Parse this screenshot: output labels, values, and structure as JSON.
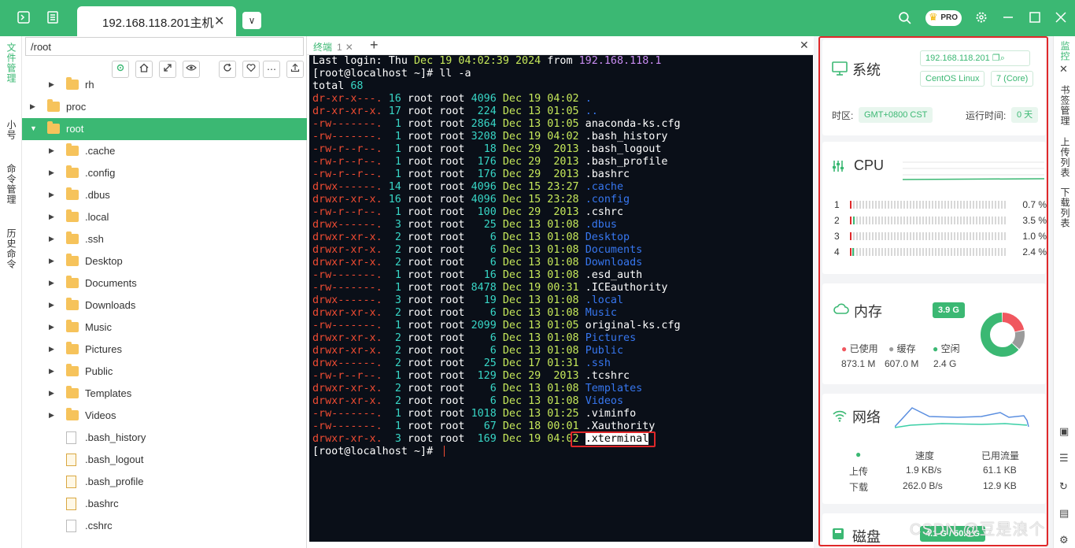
{
  "topbar": {
    "tab_title": "192.168.118.201主机",
    "tab_close": "✕",
    "dropdown": "∨",
    "pro_badge": "PRO"
  },
  "left_tabs": [
    "文件管理",
    "小号",
    "命令管理",
    "历史命令"
  ],
  "file_panel": {
    "path": "/root",
    "tree": [
      {
        "label": "rh",
        "type": "folder",
        "indent": 1,
        "arrow": "▶"
      },
      {
        "label": "proc",
        "type": "folder",
        "indent": 0,
        "arrow": "▶"
      },
      {
        "label": "root",
        "type": "folder",
        "indent": 0,
        "arrow": "▼",
        "selected": true
      },
      {
        "label": ".cache",
        "type": "folder",
        "indent": 1,
        "arrow": "▶"
      },
      {
        "label": ".config",
        "type": "folder",
        "indent": 1,
        "arrow": "▶"
      },
      {
        "label": ".dbus",
        "type": "folder",
        "indent": 1,
        "arrow": "▶"
      },
      {
        "label": ".local",
        "type": "folder",
        "indent": 1,
        "arrow": "▶"
      },
      {
        "label": ".ssh",
        "type": "folder",
        "indent": 1,
        "arrow": "▶"
      },
      {
        "label": "Desktop",
        "type": "folder",
        "indent": 1,
        "arrow": "▶"
      },
      {
        "label": "Documents",
        "type": "folder",
        "indent": 1,
        "arrow": "▶"
      },
      {
        "label": "Downloads",
        "type": "folder",
        "indent": 1,
        "arrow": "▶"
      },
      {
        "label": "Music",
        "type": "folder",
        "indent": 1,
        "arrow": "▶"
      },
      {
        "label": "Pictures",
        "type": "folder",
        "indent": 1,
        "arrow": "▶"
      },
      {
        "label": "Public",
        "type": "folder",
        "indent": 1,
        "arrow": "▶"
      },
      {
        "label": "Templates",
        "type": "folder",
        "indent": 1,
        "arrow": "▶"
      },
      {
        "label": "Videos",
        "type": "folder",
        "indent": 1,
        "arrow": "▶"
      },
      {
        "label": ".bash_history",
        "type": "file",
        "indent": 1,
        "arrow": ""
      },
      {
        "label": ".bash_logout",
        "type": "term",
        "indent": 1,
        "arrow": ""
      },
      {
        "label": ".bash_profile",
        "type": "term",
        "indent": 1,
        "arrow": ""
      },
      {
        "label": ".bashrc",
        "type": "term",
        "indent": 1,
        "arrow": ""
      },
      {
        "label": ".cshrc",
        "type": "file",
        "indent": 1,
        "arrow": ""
      }
    ]
  },
  "terminal": {
    "tab_label": "终端",
    "tab_num": "1",
    "lines": [
      [
        [
          "c-white",
          "Last login: Thu "
        ],
        [
          "c-green",
          "Dec 19 04:02:39 2024"
        ],
        [
          "c-white",
          " from "
        ],
        [
          "c-purple",
          "192.168.118.1"
        ]
      ],
      [
        [
          "c-white",
          "[root@localhost ~]# ll -a"
        ]
      ],
      [
        [
          "c-white",
          "total "
        ],
        [
          "c-cyan",
          "68"
        ]
      ],
      [
        [
          "c-red",
          "dr-xr-x---."
        ],
        [
          "c-white",
          " "
        ],
        [
          "c-cyan",
          "16"
        ],
        [
          "c-white",
          " root root "
        ],
        [
          "c-cyan",
          "4096"
        ],
        [
          "c-white",
          " "
        ],
        [
          "c-green",
          "Dec 19 04:02"
        ],
        [
          "c-white",
          " "
        ],
        [
          "c-blue",
          "."
        ]
      ],
      [
        [
          "c-red",
          "dr-xr-xr-x."
        ],
        [
          "c-white",
          " "
        ],
        [
          "c-cyan",
          "17"
        ],
        [
          "c-white",
          " root root  "
        ],
        [
          "c-cyan",
          "224"
        ],
        [
          "c-white",
          " "
        ],
        [
          "c-green",
          "Dec 13 01:05"
        ],
        [
          "c-white",
          " "
        ],
        [
          "c-blue",
          ".."
        ]
      ],
      [
        [
          "c-red",
          "-rw-------."
        ],
        [
          "c-white",
          "  "
        ],
        [
          "c-cyan",
          "1"
        ],
        [
          "c-white",
          " root root "
        ],
        [
          "c-cyan",
          "2864"
        ],
        [
          "c-white",
          " "
        ],
        [
          "c-green",
          "Dec 13 01:05"
        ],
        [
          "c-white",
          " anaconda-ks.cfg"
        ]
      ],
      [
        [
          "c-red",
          "-rw-------."
        ],
        [
          "c-white",
          "  "
        ],
        [
          "c-cyan",
          "1"
        ],
        [
          "c-white",
          " root root "
        ],
        [
          "c-cyan",
          "3208"
        ],
        [
          "c-white",
          " "
        ],
        [
          "c-green",
          "Dec 19 04:02"
        ],
        [
          "c-white",
          " .bash_history"
        ]
      ],
      [
        [
          "c-red",
          "-rw-r--r--."
        ],
        [
          "c-white",
          "  "
        ],
        [
          "c-cyan",
          "1"
        ],
        [
          "c-white",
          " root root   "
        ],
        [
          "c-cyan",
          "18"
        ],
        [
          "c-white",
          " "
        ],
        [
          "c-green",
          "Dec 29  2013"
        ],
        [
          "c-white",
          " .bash_logout"
        ]
      ],
      [
        [
          "c-red",
          "-rw-r--r--."
        ],
        [
          "c-white",
          "  "
        ],
        [
          "c-cyan",
          "1"
        ],
        [
          "c-white",
          " root root  "
        ],
        [
          "c-cyan",
          "176"
        ],
        [
          "c-white",
          " "
        ],
        [
          "c-green",
          "Dec 29  2013"
        ],
        [
          "c-white",
          " .bash_profile"
        ]
      ],
      [
        [
          "c-red",
          "-rw-r--r--."
        ],
        [
          "c-white",
          "  "
        ],
        [
          "c-cyan",
          "1"
        ],
        [
          "c-white",
          " root root  "
        ],
        [
          "c-cyan",
          "176"
        ],
        [
          "c-white",
          " "
        ],
        [
          "c-green",
          "Dec 29  2013"
        ],
        [
          "c-white",
          " .bashrc"
        ]
      ],
      [
        [
          "c-red",
          "drwx------."
        ],
        [
          "c-white",
          " "
        ],
        [
          "c-cyan",
          "14"
        ],
        [
          "c-white",
          " root root "
        ],
        [
          "c-cyan",
          "4096"
        ],
        [
          "c-white",
          " "
        ],
        [
          "c-green",
          "Dec 15 23:27"
        ],
        [
          "c-white",
          " "
        ],
        [
          "c-blue",
          ".cache"
        ]
      ],
      [
        [
          "c-red",
          "drwxr-xr-x."
        ],
        [
          "c-white",
          " "
        ],
        [
          "c-cyan",
          "16"
        ],
        [
          "c-white",
          " root root "
        ],
        [
          "c-cyan",
          "4096"
        ],
        [
          "c-white",
          " "
        ],
        [
          "c-green",
          "Dec 15 23:28"
        ],
        [
          "c-white",
          " "
        ],
        [
          "c-blue",
          ".config"
        ]
      ],
      [
        [
          "c-red",
          "-rw-r--r--."
        ],
        [
          "c-white",
          "  "
        ],
        [
          "c-cyan",
          "1"
        ],
        [
          "c-white",
          " root root  "
        ],
        [
          "c-cyan",
          "100"
        ],
        [
          "c-white",
          " "
        ],
        [
          "c-green",
          "Dec 29  2013"
        ],
        [
          "c-white",
          " .cshrc"
        ]
      ],
      [
        [
          "c-red",
          "drwx------."
        ],
        [
          "c-white",
          "  "
        ],
        [
          "c-cyan",
          "3"
        ],
        [
          "c-white",
          " root root   "
        ],
        [
          "c-cyan",
          "25"
        ],
        [
          "c-white",
          " "
        ],
        [
          "c-green",
          "Dec 13 01:08"
        ],
        [
          "c-white",
          " "
        ],
        [
          "c-blue",
          ".dbus"
        ]
      ],
      [
        [
          "c-red",
          "drwxr-xr-x."
        ],
        [
          "c-white",
          "  "
        ],
        [
          "c-cyan",
          "2"
        ],
        [
          "c-white",
          " root root    "
        ],
        [
          "c-cyan",
          "6"
        ],
        [
          "c-white",
          " "
        ],
        [
          "c-green",
          "Dec 13 01:08"
        ],
        [
          "c-white",
          " "
        ],
        [
          "c-blue",
          "Desktop"
        ]
      ],
      [
        [
          "c-red",
          "drwxr-xr-x."
        ],
        [
          "c-white",
          "  "
        ],
        [
          "c-cyan",
          "2"
        ],
        [
          "c-white",
          " root root    "
        ],
        [
          "c-cyan",
          "6"
        ],
        [
          "c-white",
          " "
        ],
        [
          "c-green",
          "Dec 13 01:08"
        ],
        [
          "c-white",
          " "
        ],
        [
          "c-blue",
          "Documents"
        ]
      ],
      [
        [
          "c-red",
          "drwxr-xr-x."
        ],
        [
          "c-white",
          "  "
        ],
        [
          "c-cyan",
          "2"
        ],
        [
          "c-white",
          " root root    "
        ],
        [
          "c-cyan",
          "6"
        ],
        [
          "c-white",
          " "
        ],
        [
          "c-green",
          "Dec 13 01:08"
        ],
        [
          "c-white",
          " "
        ],
        [
          "c-blue",
          "Downloads"
        ]
      ],
      [
        [
          "c-red",
          "-rw-------."
        ],
        [
          "c-white",
          "  "
        ],
        [
          "c-cyan",
          "1"
        ],
        [
          "c-white",
          " root root   "
        ],
        [
          "c-cyan",
          "16"
        ],
        [
          "c-white",
          " "
        ],
        [
          "c-green",
          "Dec 13 01:08"
        ],
        [
          "c-white",
          " .esd_auth"
        ]
      ],
      [
        [
          "c-red",
          "-rw-------."
        ],
        [
          "c-white",
          "  "
        ],
        [
          "c-cyan",
          "1"
        ],
        [
          "c-white",
          " root root "
        ],
        [
          "c-cyan",
          "8478"
        ],
        [
          "c-white",
          " "
        ],
        [
          "c-green",
          "Dec 19 00:31"
        ],
        [
          "c-white",
          " .ICEauthority"
        ]
      ],
      [
        [
          "c-red",
          "drwx------."
        ],
        [
          "c-white",
          "  "
        ],
        [
          "c-cyan",
          "3"
        ],
        [
          "c-white",
          " root root   "
        ],
        [
          "c-cyan",
          "19"
        ],
        [
          "c-white",
          " "
        ],
        [
          "c-green",
          "Dec 13 01:08"
        ],
        [
          "c-white",
          " "
        ],
        [
          "c-blue",
          ".local"
        ]
      ],
      [
        [
          "c-red",
          "drwxr-xr-x."
        ],
        [
          "c-white",
          "  "
        ],
        [
          "c-cyan",
          "2"
        ],
        [
          "c-white",
          " root root    "
        ],
        [
          "c-cyan",
          "6"
        ],
        [
          "c-white",
          " "
        ],
        [
          "c-green",
          "Dec 13 01:08"
        ],
        [
          "c-white",
          " "
        ],
        [
          "c-blue",
          "Music"
        ]
      ],
      [
        [
          "c-red",
          "-rw-------."
        ],
        [
          "c-white",
          "  "
        ],
        [
          "c-cyan",
          "1"
        ],
        [
          "c-white",
          " root root "
        ],
        [
          "c-cyan",
          "2099"
        ],
        [
          "c-white",
          " "
        ],
        [
          "c-green",
          "Dec 13 01:05"
        ],
        [
          "c-white",
          " original-ks.cfg"
        ]
      ],
      [
        [
          "c-red",
          "drwxr-xr-x."
        ],
        [
          "c-white",
          "  "
        ],
        [
          "c-cyan",
          "2"
        ],
        [
          "c-white",
          " root root    "
        ],
        [
          "c-cyan",
          "6"
        ],
        [
          "c-white",
          " "
        ],
        [
          "c-green",
          "Dec 13 01:08"
        ],
        [
          "c-white",
          " "
        ],
        [
          "c-blue",
          "Pictures"
        ]
      ],
      [
        [
          "c-red",
          "drwxr-xr-x."
        ],
        [
          "c-white",
          "  "
        ],
        [
          "c-cyan",
          "2"
        ],
        [
          "c-white",
          " root root    "
        ],
        [
          "c-cyan",
          "6"
        ],
        [
          "c-white",
          " "
        ],
        [
          "c-green",
          "Dec 13 01:08"
        ],
        [
          "c-white",
          " "
        ],
        [
          "c-blue",
          "Public"
        ]
      ],
      [
        [
          "c-red",
          "drwx------."
        ],
        [
          "c-white",
          "  "
        ],
        [
          "c-cyan",
          "2"
        ],
        [
          "c-white",
          " root root   "
        ],
        [
          "c-cyan",
          "25"
        ],
        [
          "c-white",
          " "
        ],
        [
          "c-green",
          "Dec 17 01:31"
        ],
        [
          "c-white",
          " "
        ],
        [
          "c-blue",
          ".ssh"
        ]
      ],
      [
        [
          "c-red",
          "-rw-r--r--."
        ],
        [
          "c-white",
          "  "
        ],
        [
          "c-cyan",
          "1"
        ],
        [
          "c-white",
          " root root  "
        ],
        [
          "c-cyan",
          "129"
        ],
        [
          "c-white",
          " "
        ],
        [
          "c-green",
          "Dec 29  2013"
        ],
        [
          "c-white",
          " .tcshrc"
        ]
      ],
      [
        [
          "c-red",
          "drwxr-xr-x."
        ],
        [
          "c-white",
          "  "
        ],
        [
          "c-cyan",
          "2"
        ],
        [
          "c-white",
          " root root    "
        ],
        [
          "c-cyan",
          "6"
        ],
        [
          "c-white",
          " "
        ],
        [
          "c-green",
          "Dec 13 01:08"
        ],
        [
          "c-white",
          " "
        ],
        [
          "c-blue",
          "Templates"
        ]
      ],
      [
        [
          "c-red",
          "drwxr-xr-x."
        ],
        [
          "c-white",
          "  "
        ],
        [
          "c-cyan",
          "2"
        ],
        [
          "c-white",
          " root root    "
        ],
        [
          "c-cyan",
          "6"
        ],
        [
          "c-white",
          " "
        ],
        [
          "c-green",
          "Dec 13 01:08"
        ],
        [
          "c-white",
          " "
        ],
        [
          "c-blue",
          "Videos"
        ]
      ],
      [
        [
          "c-red",
          "-rw-------."
        ],
        [
          "c-white",
          "  "
        ],
        [
          "c-cyan",
          "1"
        ],
        [
          "c-white",
          " root root "
        ],
        [
          "c-cyan",
          "1018"
        ],
        [
          "c-white",
          " "
        ],
        [
          "c-green",
          "Dec 13 01:25"
        ],
        [
          "c-white",
          " .viminfo"
        ]
      ],
      [
        [
          "c-red",
          "-rw-------."
        ],
        [
          "c-white",
          "  "
        ],
        [
          "c-cyan",
          "1"
        ],
        [
          "c-white",
          " root root   "
        ],
        [
          "c-cyan",
          "67"
        ],
        [
          "c-white",
          " "
        ],
        [
          "c-green",
          "Dec 18 00:01"
        ],
        [
          "c-white",
          " .Xauthority"
        ]
      ],
      [
        [
          "c-red",
          "drwxr-xr-x."
        ],
        [
          "c-white",
          "  "
        ],
        [
          "c-cyan",
          "3"
        ],
        [
          "c-white",
          " root root  "
        ],
        [
          "c-cyan",
          "169"
        ],
        [
          "c-white",
          " "
        ],
        [
          "c-green",
          "Dec 19 04:02"
        ],
        [
          "c-white",
          " "
        ],
        [
          "c-hl",
          ".xterminal"
        ]
      ],
      [
        [
          "c-white",
          "[root@localhost ~]# "
        ]
      ]
    ]
  },
  "monitor": {
    "system": {
      "title": "系统",
      "ip": "192.168.118.201",
      "os": "CentOS Linux",
      "version": "7 (Core)",
      "tz_label": "时区:",
      "tz_value": "GMT+0800   CST",
      "uptime_label": "运行时间:",
      "uptime_value": "0 天"
    },
    "cpu": {
      "title": "CPU",
      "cores": [
        {
          "id": "1",
          "value": "0.7 %",
          "pct": 0.7
        },
        {
          "id": "2",
          "value": "3.5 %",
          "pct": 3.5
        },
        {
          "id": "3",
          "value": "1.0 %",
          "pct": 1.0
        },
        {
          "id": "4",
          "value": "2.4 %",
          "pct": 2.4
        }
      ]
    },
    "memory": {
      "title": "内存",
      "total": "3.9 G",
      "used_label": "已使用",
      "cache_label": "缓存",
      "free_label": "空闲",
      "used_value": "873.1 M",
      "cache_value": "607.0 M",
      "free_value": "2.4 G",
      "used_pct": 22,
      "cache_pct": 15,
      "free_pct": 63,
      "colors": {
        "used": "#f0575f",
        "cache": "#9b9b9b",
        "free": "#3bb873"
      }
    },
    "network": {
      "title": "网络",
      "col_speed": "速度",
      "col_used": "已用流量",
      "up_label": "上传",
      "down_label": "下载",
      "up_speed": "1.9 KB/s",
      "up_used": "61.1 KB",
      "down_speed": "262.0 B/s",
      "down_used": "12.9 KB"
    },
    "disk": {
      "title": "磁盘",
      "value": "4.1 G / 50.8 G"
    }
  },
  "right_tabs": [
    "监控",
    "书签管理",
    "上传列表",
    "下载列表"
  ],
  "watermark": "CSDN @豆是浪个",
  "accent": "#3bb873"
}
